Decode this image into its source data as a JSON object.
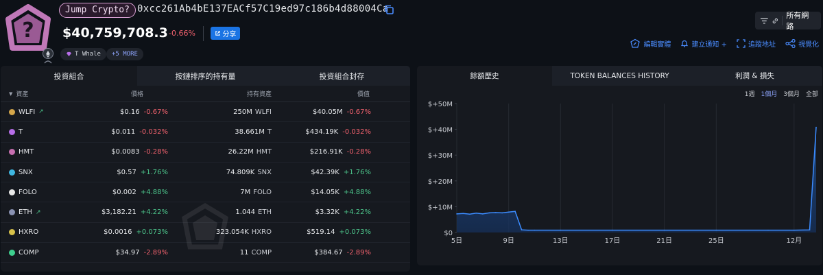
{
  "header": {
    "entity_label": "Jump Crypto?",
    "address": "0xcc261Ab4bE137EACf57C19ed97c186b4d88004Ca",
    "balance": "$40,759,708.3",
    "balance_change": "-0.66%",
    "share_label": "分享",
    "tags": [
      {
        "label": "T Whale"
      },
      {
        "label": "+5 MORE"
      }
    ],
    "network_label": "所有網路",
    "actions": [
      {
        "label": "編輯實體",
        "icon": "edit-entity-icon"
      },
      {
        "label": "建立通知 +",
        "icon": "bell-icon"
      },
      {
        "label": "追蹤地址",
        "icon": "track-icon"
      },
      {
        "label": "視覺化",
        "icon": "graph-icon"
      }
    ]
  },
  "portfolio": {
    "tabs": [
      "投資組合",
      "按鏈排序的持有量",
      "投資組合封存"
    ],
    "columns": [
      "資產",
      "價格",
      "持有資產",
      "價值"
    ],
    "rows": [
      {
        "symbol": "WLFI",
        "price": "$0.16",
        "price_change": "-0.67%",
        "holding": "250M",
        "holding_unit": "WLFI",
        "value": "$40.05M",
        "value_change": "-0.67%",
        "color": "#d4a64a"
      },
      {
        "symbol": "T",
        "price": "$0.011",
        "price_change": "-0.032%",
        "holding": "38.661M",
        "holding_unit": "T",
        "value": "$434.19K",
        "value_change": "-0.032%",
        "color": "#b76ee8"
      },
      {
        "symbol": "HMT",
        "price": "$0.0083",
        "price_change": "-0.28%",
        "holding": "26.22M",
        "holding_unit": "HMT",
        "value": "$216.91K",
        "value_change": "-0.28%",
        "color": "#c76fb0"
      },
      {
        "symbol": "SNX",
        "price": "$0.57",
        "price_change": "+1.76%",
        "holding": "74.809K",
        "holding_unit": "SNX",
        "value": "$42.39K",
        "value_change": "+1.76%",
        "color": "#3fb6e0"
      },
      {
        "symbol": "FOLO",
        "price": "$0.002",
        "price_change": "+4.88%",
        "holding": "7M",
        "holding_unit": "FOLO",
        "value": "$14.05K",
        "value_change": "+4.88%",
        "color": "#e8e8e8"
      },
      {
        "symbol": "ETH",
        "price": "$3,182.21",
        "price_change": "+4.22%",
        "holding": "1.044",
        "holding_unit": "ETH",
        "value": "$3.32K",
        "value_change": "+4.22%",
        "color": "#8a92b2"
      },
      {
        "symbol": "HXRO",
        "price": "$0.0016",
        "price_change": "+0.073%",
        "holding": "323.054K",
        "holding_unit": "HXRO",
        "value": "$519.14",
        "value_change": "+0.073%",
        "color": "#d8c24a"
      },
      {
        "symbol": "COMP",
        "price": "$34.97",
        "price_change": "-2.89%",
        "holding": "11",
        "holding_unit": "COMP",
        "value": "$384.67",
        "value_change": "-2.89%",
        "color": "#3ecf8e"
      }
    ]
  },
  "history": {
    "tabs": [
      "餘額歷史",
      "TOKEN BALANCES HISTORY",
      "利潤 & 損失"
    ],
    "ranges": [
      "1週",
      "1個月",
      "3個月",
      "全部"
    ],
    "active_range": "1個月"
  },
  "chart_data": {
    "type": "area",
    "title": "",
    "ylabel": "",
    "xlabel": "",
    "y_ticks": [
      "$+50M",
      "$+40M",
      "$+30M",
      "$+20M",
      "$+10M",
      "$0"
    ],
    "ylim": [
      0,
      50
    ],
    "x_tick_labels": [
      "5日",
      "9日",
      "13日",
      "17日",
      "21日",
      "25日",
      "12月"
    ],
    "x_tick_days": [
      5,
      9,
      13,
      17,
      21,
      25,
      31
    ],
    "xlim": [
      5,
      32.7
    ],
    "series": [
      {
        "x": [
          5,
          5.5,
          6,
          6.5,
          7,
          7.5,
          8,
          8.5,
          9,
          9.5,
          10,
          10.5,
          11,
          13,
          17,
          21,
          25,
          29,
          31,
          32.2,
          32.7
        ],
        "y": [
          7.2,
          7.4,
          7.1,
          7.5,
          7.2,
          7.6,
          7.7,
          7.6,
          7.9,
          8.2,
          1.0,
          0.9,
          0.9,
          0.9,
          0.9,
          0.9,
          0.9,
          0.9,
          0.9,
          1.0,
          40.8
        ],
        "color": "#3c8cff"
      }
    ],
    "grid": "vertical"
  }
}
